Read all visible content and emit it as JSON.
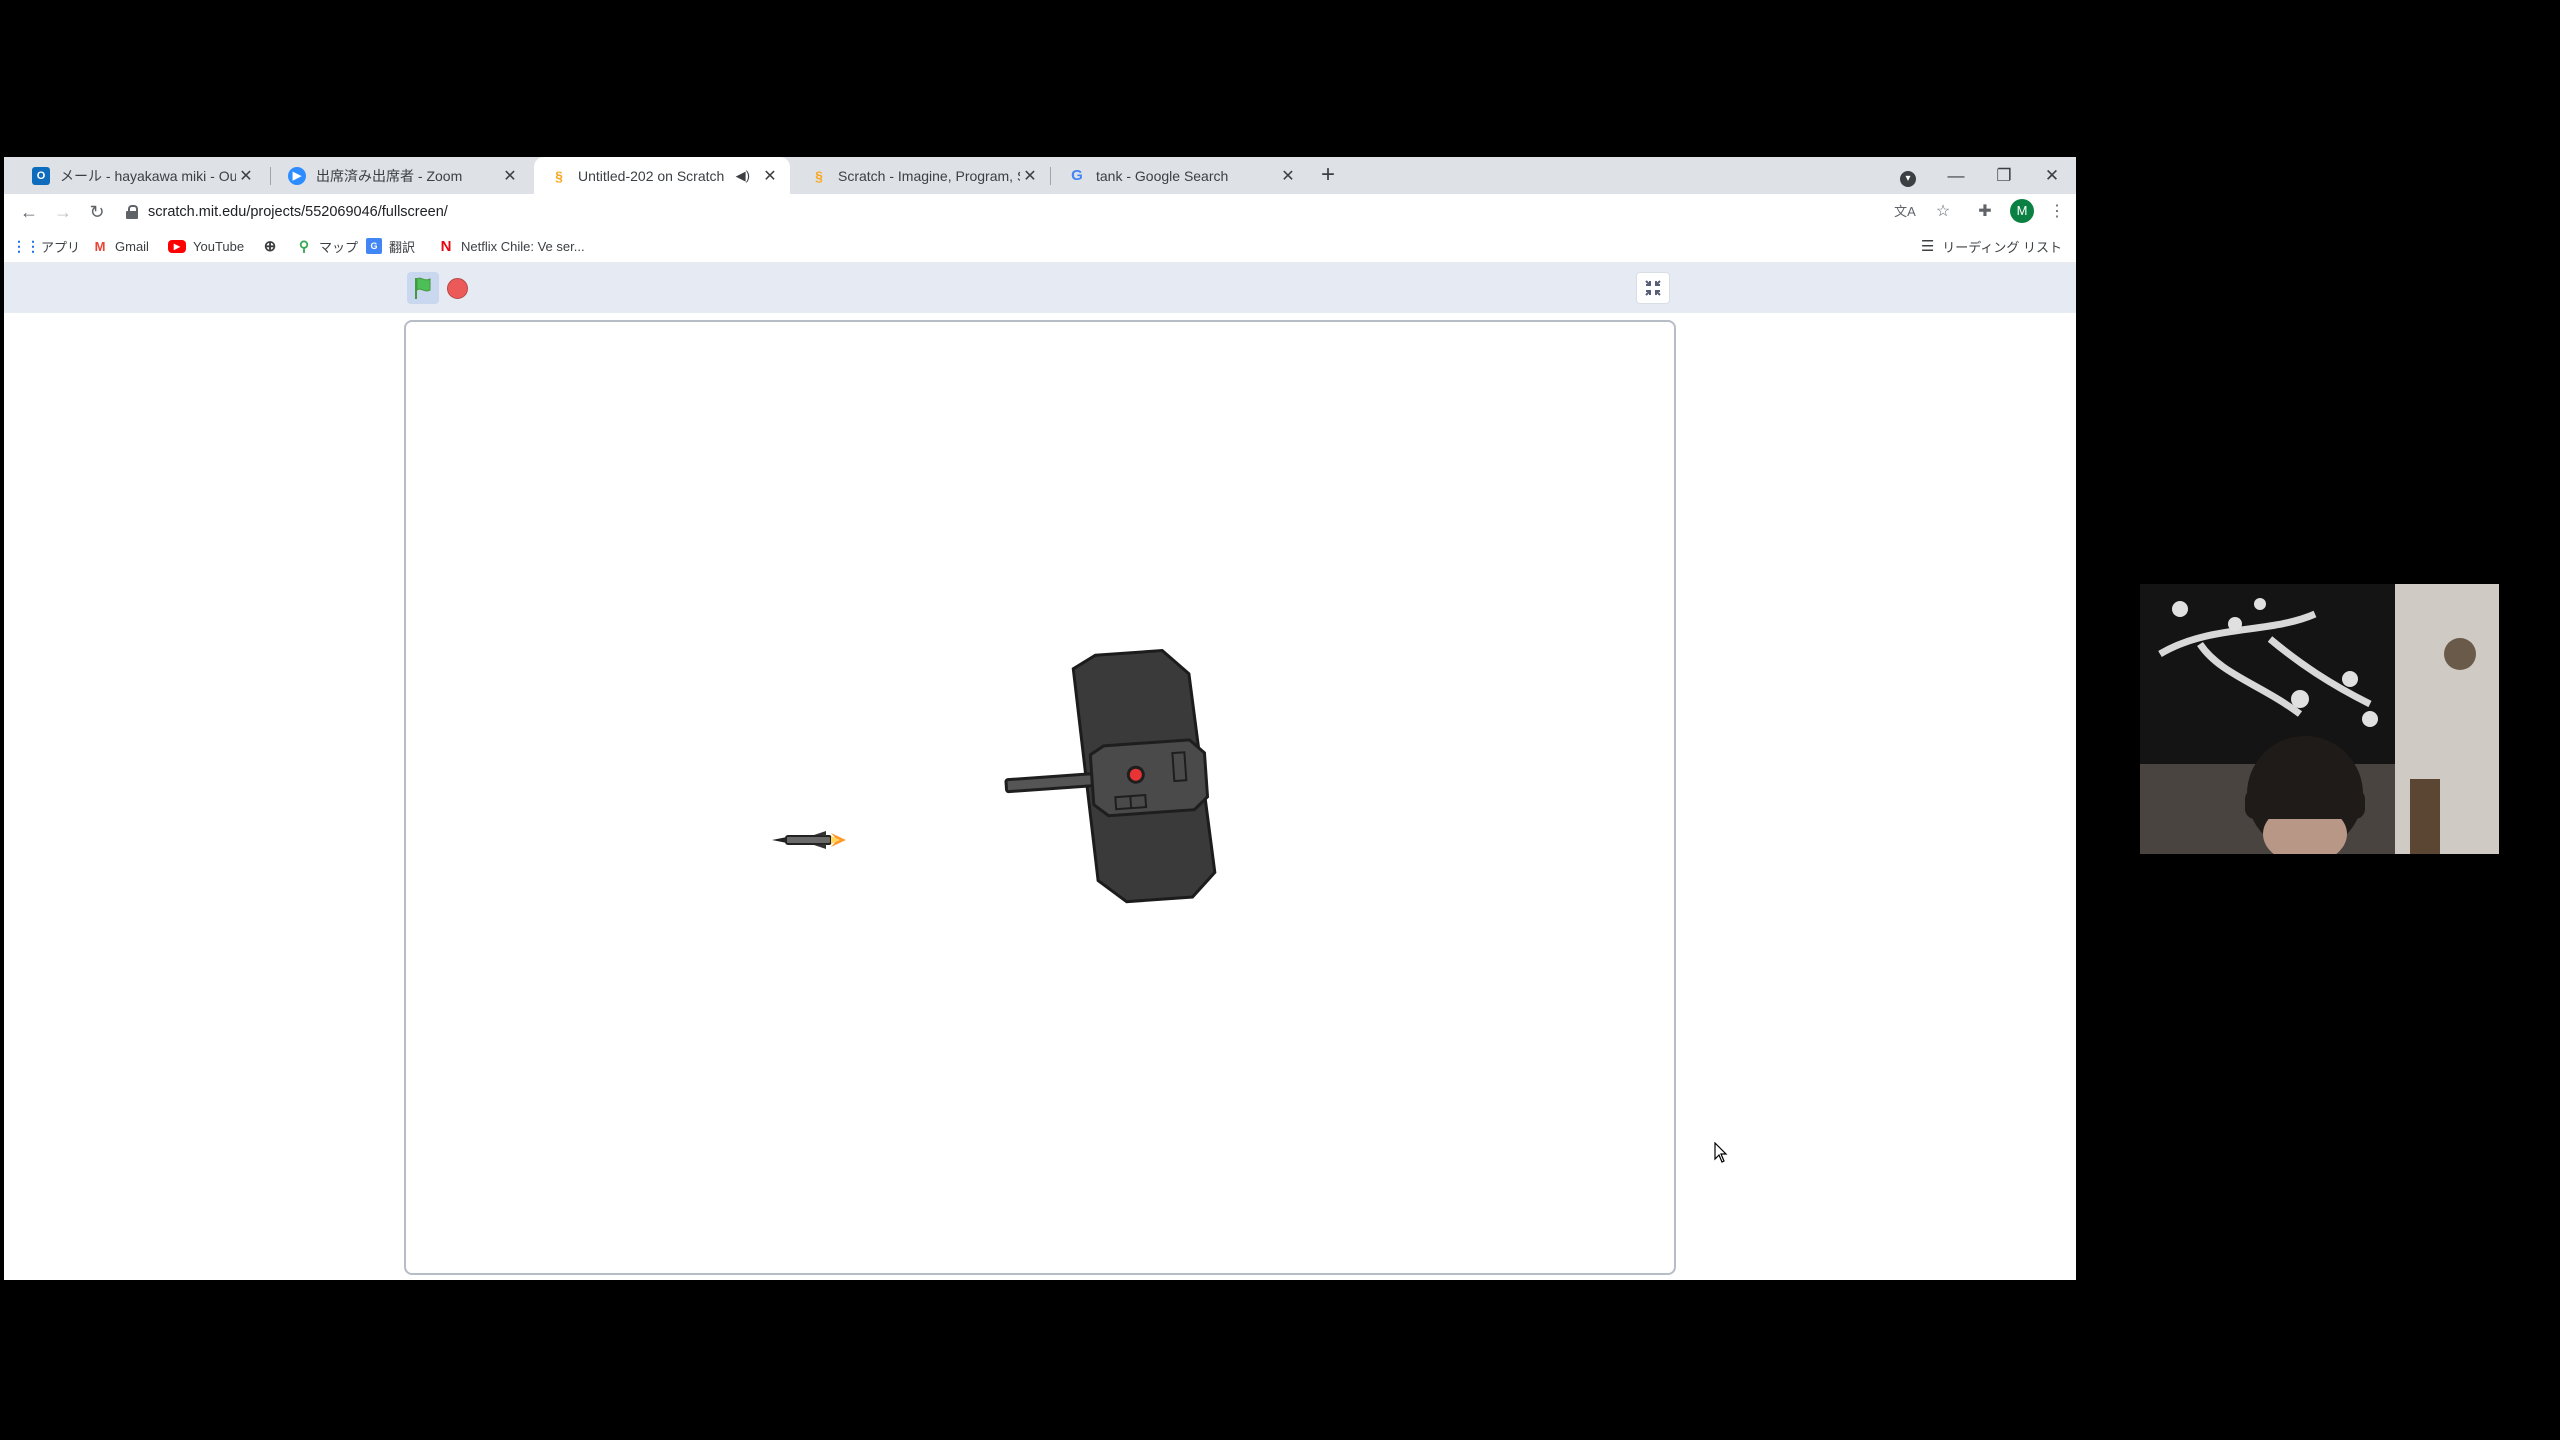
{
  "tabs": [
    {
      "title": "メール - hayakawa miki - Outlook",
      "favicon": "outlook-icon",
      "color": "#0f6cbd",
      "active": false
    },
    {
      "title": "出席済み出席者 - Zoom",
      "favicon": "zoom-icon",
      "color": "#2d8cff",
      "active": false
    },
    {
      "title": "Untitled-202 on Scratch",
      "favicon": "scratch-icon",
      "color": "#f9a825",
      "active": true
    },
    {
      "title": "Scratch - Imagine, Program, Sha",
      "favicon": "scratch-icon",
      "color": "#f9a825",
      "active": false
    },
    {
      "title": "tank - Google Search",
      "favicon": "google-icon",
      "color": "#4285f4",
      "active": false
    }
  ],
  "address_bar": {
    "url": "scratch.mit.edu/projects/552069046/fullscreen/"
  },
  "profile": {
    "initial": "M"
  },
  "bookmarks": [
    {
      "label": "アプリ",
      "icon": "apps-grid-icon"
    },
    {
      "label": "Gmail",
      "icon": "gmail-icon"
    },
    {
      "label": "YouTube",
      "icon": "youtube-icon"
    },
    {
      "label": "",
      "icon": "globe-icon"
    },
    {
      "label": "マップ",
      "icon": "maps-pin-icon"
    },
    {
      "label": "翻訳",
      "icon": "translate-icon"
    },
    {
      "label": "Netflix Chile: Ve ser...",
      "icon": "netflix-icon"
    }
  ],
  "reading_list": {
    "label": "リーディング リスト"
  },
  "colors": {
    "tabstrip": "#dee1e6",
    "scratch_header": "#e6ebf3",
    "stop": "#ec5959",
    "flag": "#4cbf56",
    "tank_body": "#3a3a3a",
    "tank_light": "#e83434"
  }
}
